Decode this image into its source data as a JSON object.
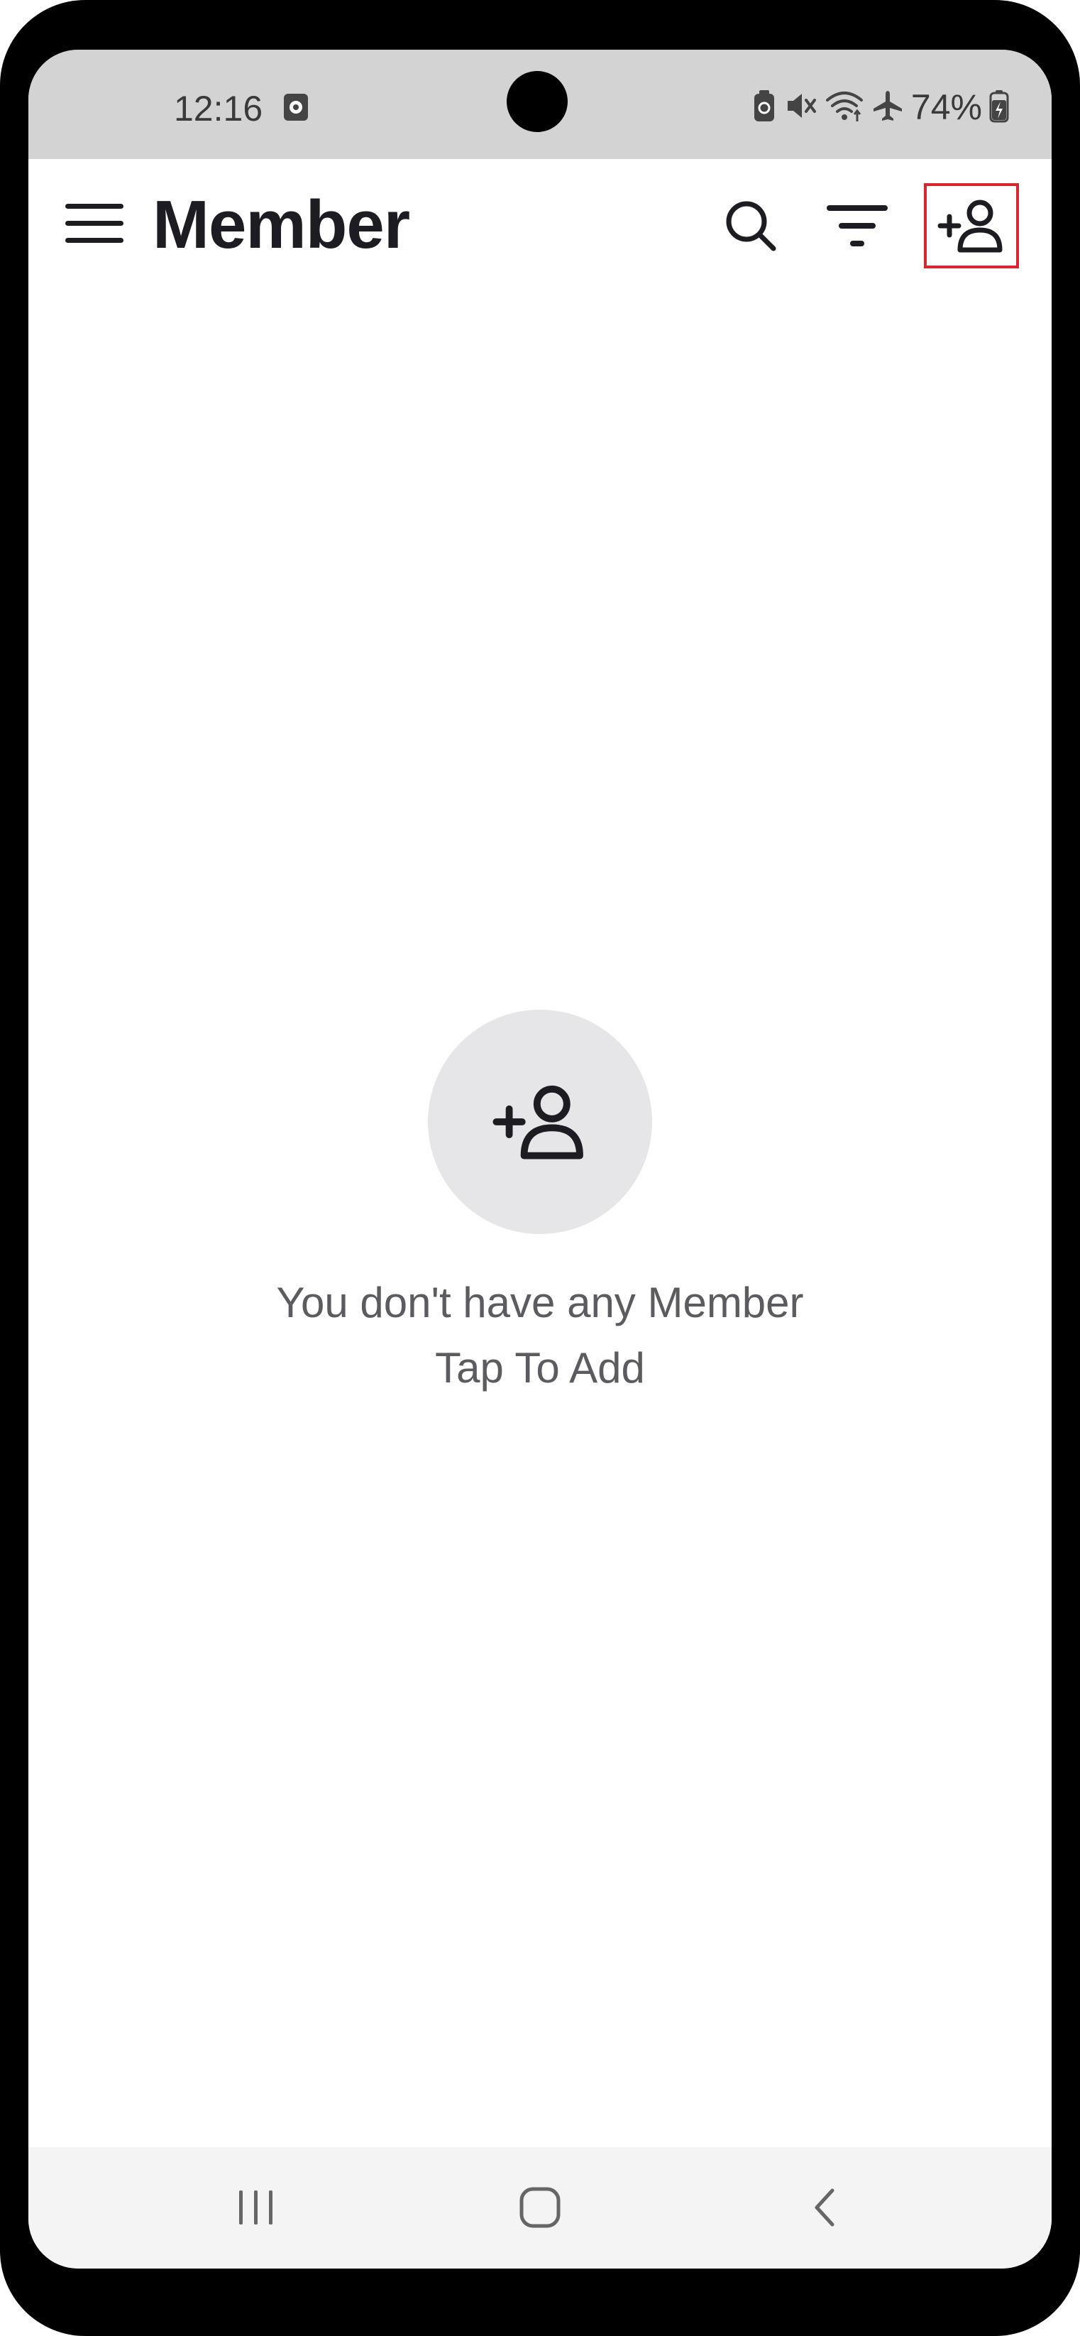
{
  "status_bar": {
    "time": "12:16",
    "battery_percent": "74%"
  },
  "app_bar": {
    "title": "Member",
    "icons": {
      "menu": "hamburger-menu-icon",
      "search": "search-icon",
      "filter": "filter-icon",
      "add_member": "add-person-icon"
    }
  },
  "empty_state": {
    "icon": "add-person-icon",
    "line1": "You don't have any Member",
    "line2": "Tap To Add"
  },
  "nav_bar": {
    "icons": [
      "recents-icon",
      "home-icon",
      "back-icon"
    ]
  },
  "colors": {
    "status_bar_bg": "#d3d3d3",
    "title_text": "#1c1c22",
    "highlight_border": "#d8262f",
    "empty_circle_bg": "#e6e6e8",
    "empty_text": "#5b5b60",
    "nav_bar_bg": "#f4f4f4"
  }
}
